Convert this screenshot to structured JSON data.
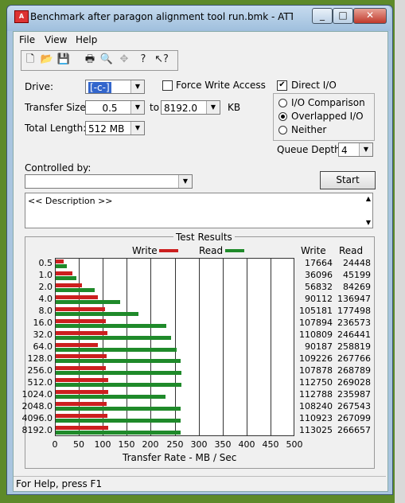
{
  "window": {
    "title": "Benchmark after paragon alignment tool run.bmk - ATTO Disk...",
    "minimize": "_",
    "maximize": "□",
    "close": "✕"
  },
  "menu": [
    "File",
    "View",
    "Help"
  ],
  "toolbar": {
    "icons": [
      "new-file-icon",
      "open-folder-icon",
      "save-icon",
      "print-icon",
      "print-preview-icon",
      "move-icon",
      "help-icon",
      "context-help-icon"
    ]
  },
  "form": {
    "drive_label": "Drive:",
    "drive_value": "[-c-]",
    "force_write_label": "Force Write Access",
    "direct_io_label": "Direct I/O",
    "direct_io_checked": true,
    "transfer_size_label": "Transfer Size:",
    "transfer_from": "0.5",
    "to_label": "to",
    "transfer_to": "8192.0",
    "kb_label": "KB",
    "total_length_label": "Total Length:",
    "total_length_value": "512 MB",
    "io_comparison_label": "I/O Comparison",
    "overlapped_label": "Overlapped I/O",
    "neither_label": "Neither",
    "queue_depth_label": "Queue Depth:",
    "queue_depth_value": "4",
    "controlled_by_label": "Controlled by:",
    "controlled_by_value": "",
    "start_label": "Start",
    "description": "<< Description >>"
  },
  "results": {
    "title": "Test Results",
    "write_header": "Write",
    "read_header": "Read"
  },
  "chart_data": {
    "type": "bar",
    "orientation": "horizontal",
    "title": "Test Results",
    "xlabel": "Transfer Rate - MB / Sec",
    "xlim": [
      0,
      500
    ],
    "xticks": [
      "0",
      "50",
      "100",
      "150",
      "200",
      "250",
      "300",
      "350",
      "400",
      "450",
      "500"
    ],
    "categories": [
      "0.5",
      "1.0",
      "2.0",
      "4.0",
      "8.0",
      "16.0",
      "32.0",
      "64.0",
      "128.0",
      "256.0",
      "512.0",
      "1024.0",
      "2048.0",
      "4096.0",
      "8192.0"
    ],
    "series": [
      {
        "name": "Write",
        "color": "#cc1f1f",
        "values": [
          17,
          35,
          55,
          88,
          103,
          105,
          108,
          88,
          107,
          105,
          110,
          110,
          106,
          108,
          110
        ],
        "labels": [
          "17664",
          "36096",
          "56832",
          "90112",
          "105181",
          "107894",
          "110809",
          "90187",
          "109226",
          "107878",
          "112750",
          "112788",
          "108240",
          "110923",
          "113025"
        ]
      },
      {
        "name": "Read",
        "color": "#1f8a2a",
        "values": [
          24,
          44,
          82,
          134,
          173,
          231,
          241,
          253,
          261,
          263,
          263,
          230,
          261,
          261,
          260
        ],
        "labels": [
          "24448",
          "45199",
          "84269",
          "136947",
          "177498",
          "236573",
          "246441",
          "258819",
          "267766",
          "268789",
          "269028",
          "235987",
          "267543",
          "267099",
          "266657"
        ]
      }
    ],
    "grid": true,
    "legend": "top"
  },
  "status": "For Help, press F1"
}
